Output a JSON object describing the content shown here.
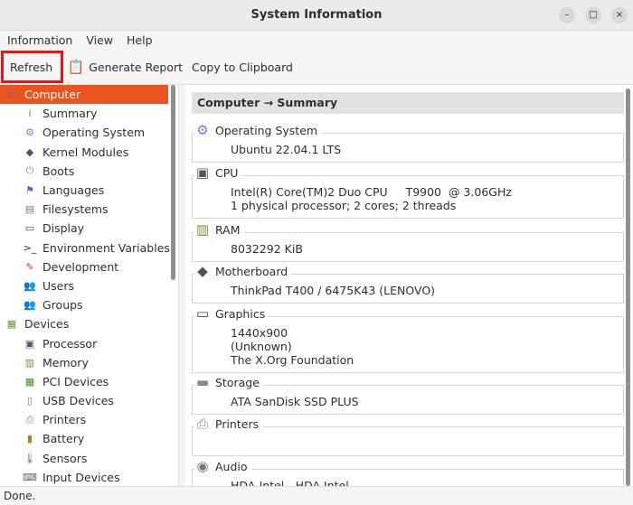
{
  "window": {
    "title": "System Information",
    "minimize": "–",
    "maximize": "□",
    "close": "×"
  },
  "menu": [
    "Information",
    "View",
    "Help"
  ],
  "toolbar": {
    "refresh": "Refresh",
    "generate_report": "Generate Report",
    "copy": "Copy to Clipboard"
  },
  "sidebar": [
    {
      "label": "Computer",
      "type": "cat",
      "icon": "computer-icon",
      "sym": "▭",
      "color": "#4a6fa5",
      "selected": true
    },
    {
      "label": "Summary",
      "type": "sub",
      "icon": "info-icon",
      "sym": "i",
      "color": "#3d7bd6"
    },
    {
      "label": "Operating System",
      "type": "sub",
      "icon": "gear-icon",
      "sym": "⚙",
      "color": "#6f86c6"
    },
    {
      "label": "Kernel Modules",
      "type": "sub",
      "icon": "module-icon",
      "sym": "◆",
      "color": "#4f4f6a"
    },
    {
      "label": "Boots",
      "type": "sub",
      "icon": "power-icon",
      "sym": "⏻",
      "color": "#8a8a8a"
    },
    {
      "label": "Languages",
      "type": "sub",
      "icon": "flag-icon",
      "sym": "⚑",
      "color": "#3b70c5"
    },
    {
      "label": "Filesystems",
      "type": "sub",
      "icon": "filesystem-icon",
      "sym": "▤",
      "color": "#7a7a7a"
    },
    {
      "label": "Display",
      "type": "sub",
      "icon": "monitor-icon",
      "sym": "▭",
      "color": "#445"
    },
    {
      "label": "Environment Variables",
      "type": "sub",
      "icon": "terminal-icon",
      "sym": ">_",
      "color": "#333"
    },
    {
      "label": "Development",
      "type": "sub",
      "icon": "development-icon",
      "sym": "✎",
      "color": "#c33"
    },
    {
      "label": "Users",
      "type": "sub",
      "icon": "users-icon",
      "sym": "👥",
      "color": "#c08040"
    },
    {
      "label": "Groups",
      "type": "sub",
      "icon": "groups-icon",
      "sym": "👥",
      "color": "#c08040"
    },
    {
      "label": "Devices",
      "type": "cat",
      "icon": "devices-icon",
      "sym": "▦",
      "color": "#6a9a2a"
    },
    {
      "label": "Processor",
      "type": "sub",
      "icon": "cpu-icon",
      "sym": "▣",
      "color": "#555"
    },
    {
      "label": "Memory",
      "type": "sub",
      "icon": "memory-icon",
      "sym": "▥",
      "color": "#6a9a2a"
    },
    {
      "label": "PCI Devices",
      "type": "sub",
      "icon": "pci-icon",
      "sym": "▦",
      "color": "#4a8a2a"
    },
    {
      "label": "USB Devices",
      "type": "sub",
      "icon": "usb-icon",
      "sym": "▯",
      "color": "#777"
    },
    {
      "label": "Printers",
      "type": "sub",
      "icon": "printer-icon",
      "sym": "⎙",
      "color": "#888"
    },
    {
      "label": "Battery",
      "type": "sub",
      "icon": "battery-icon",
      "sym": "▮",
      "color": "#b08030"
    },
    {
      "label": "Sensors",
      "type": "sub",
      "icon": "sensor-icon",
      "sym": "🌡",
      "color": "#777"
    },
    {
      "label": "Input Devices",
      "type": "sub",
      "icon": "keyboard-icon",
      "sym": "⌨",
      "color": "#666"
    }
  ],
  "main": {
    "header": "Computer → Summary",
    "sections": [
      {
        "title": "Operating System",
        "icon": "gear-icon",
        "sym": "⚙",
        "color": "#6f86c6",
        "lines": [
          "Ubuntu 22.04.1 LTS"
        ]
      },
      {
        "title": "CPU",
        "icon": "cpu-icon",
        "sym": "▣",
        "color": "#555",
        "lines": [
          "Intel(R) Core(TM)2 Duo CPU     T9900  @ 3.06GHz",
          "1 physical processor; 2 cores; 2 threads"
        ]
      },
      {
        "title": "RAM",
        "icon": "memory-icon",
        "sym": "▥",
        "color": "#6a9a2a",
        "lines": [
          "8032292 KiB"
        ]
      },
      {
        "title": "Motherboard",
        "icon": "motherboard-icon",
        "sym": "◆",
        "color": "#4f4f6a",
        "lines": [
          "ThinkPad T400 / 6475K43 (LENOVO)"
        ]
      },
      {
        "title": "Graphics",
        "icon": "monitor-icon",
        "sym": "▭",
        "color": "#445",
        "lines": [
          "1440x900",
          "(Unknown)",
          "The X.Org Foundation"
        ]
      },
      {
        "title": "Storage",
        "icon": "storage-icon",
        "sym": "▬",
        "color": "#888",
        "lines": [
          "ATA SanDisk SSD PLUS"
        ]
      },
      {
        "title": "Printers",
        "icon": "printer-icon",
        "sym": "⎙",
        "color": "#888",
        "lines": []
      },
      {
        "title": "Audio",
        "icon": "audio-icon",
        "sym": "◉",
        "color": "#777",
        "lines": [
          "HDA-Intel - HDA Intel"
        ]
      }
    ]
  },
  "status": "Done."
}
